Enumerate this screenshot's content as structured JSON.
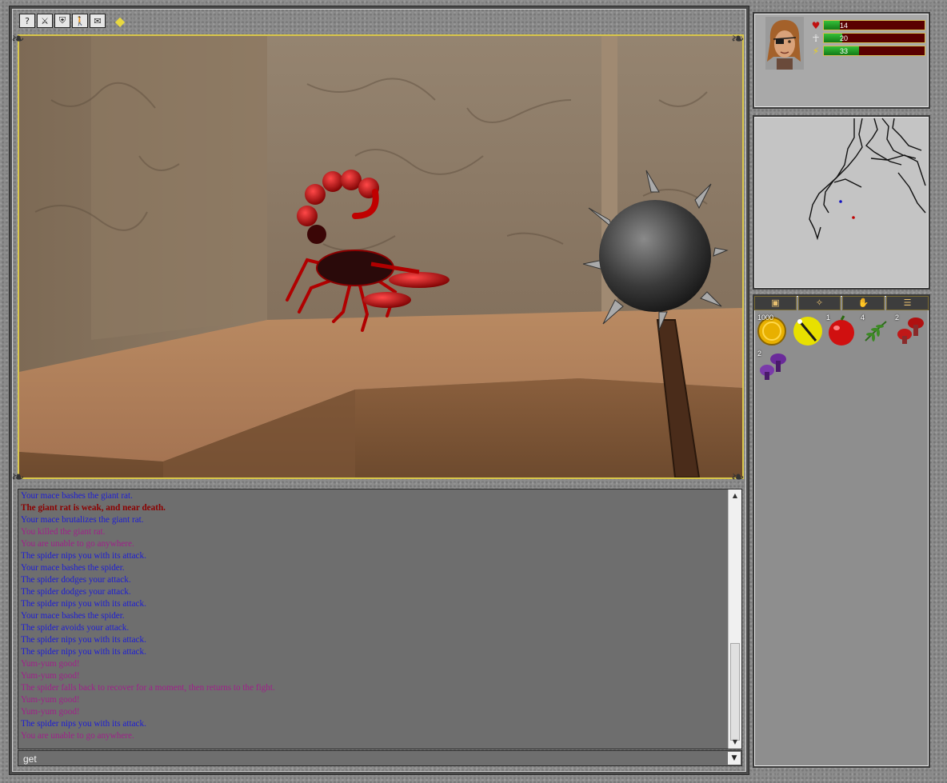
{
  "toolbar": {
    "buttons": [
      {
        "name": "help",
        "glyph": "?"
      },
      {
        "name": "weapon",
        "glyph": "⚔"
      },
      {
        "name": "armor",
        "glyph": "⛨"
      },
      {
        "name": "character",
        "glyph": "🚶"
      },
      {
        "name": "mail",
        "glyph": "✉"
      }
    ],
    "gem_glyph": "◆"
  },
  "stats": {
    "health": {
      "value": "14",
      "fraction": 0.16,
      "icon": "♥"
    },
    "mana": {
      "value": "20",
      "fraction": 0.18,
      "icon": "☥"
    },
    "stamina": {
      "value": "33",
      "fraction": 0.35,
      "icon": "⚡"
    }
  },
  "log": {
    "lines": [
      {
        "text": "Your mace bashes the giant rat.",
        "style": "blue"
      },
      {
        "text": "The giant rat is weak, and near death.",
        "style": "red"
      },
      {
        "text": "Your mace brutalizes the giant rat.",
        "style": "blue"
      },
      {
        "text": "You killed the giant rat.",
        "style": "purple"
      },
      {
        "text": "You are unable to go anywhere.",
        "style": "purple"
      },
      {
        "text": "The spider nips you with its attack.",
        "style": "blue"
      },
      {
        "text": "Your mace bashes the spider.",
        "style": "blue"
      },
      {
        "text": "The spider dodges your attack.",
        "style": "blue"
      },
      {
        "text": "The spider dodges your attack.",
        "style": "blue"
      },
      {
        "text": "The spider nips you with its attack.",
        "style": "blue"
      },
      {
        "text": "Your mace bashes the spider.",
        "style": "blue"
      },
      {
        "text": "The spider avoids your attack.",
        "style": "blue"
      },
      {
        "text": "The spider nips you with its attack.",
        "style": "blue"
      },
      {
        "text": "The spider nips you with its attack.",
        "style": "blue"
      },
      {
        "text": "Yum-yum good!",
        "style": "purple"
      },
      {
        "text": "Yum-yum good!",
        "style": "purple"
      },
      {
        "text": "The spider falls back to recover for a moment, then returns to the fight.",
        "style": "purple"
      },
      {
        "text": "Yum-yum good!",
        "style": "purple"
      },
      {
        "text": "Yum-yum good!",
        "style": "purple"
      },
      {
        "text": "The spider nips you with its attack.",
        "style": "blue"
      },
      {
        "text": "You are unable to go anywhere.",
        "style": "purple"
      }
    ]
  },
  "command": {
    "value": "get"
  },
  "inventory": {
    "tabs": [
      {
        "name": "items",
        "glyph": "▣"
      },
      {
        "name": "spells",
        "glyph": "✧"
      },
      {
        "name": "hand",
        "glyph": "✋"
      },
      {
        "name": "list",
        "glyph": "☰"
      }
    ],
    "items": [
      {
        "name": "gold-coins",
        "qty": "1000"
      },
      {
        "name": "magic-wand",
        "qty": ""
      },
      {
        "name": "apple",
        "qty": "1"
      },
      {
        "name": "herb",
        "qty": "4"
      },
      {
        "name": "red-mushroom",
        "qty": "2"
      },
      {
        "name": "purple-mushroom",
        "qty": "2"
      }
    ]
  },
  "colors": {
    "log_blue": "#1d1dd6",
    "log_purple": "#a0208a",
    "log_red": "#8c0000",
    "viewport_border": "#d8c64a"
  }
}
